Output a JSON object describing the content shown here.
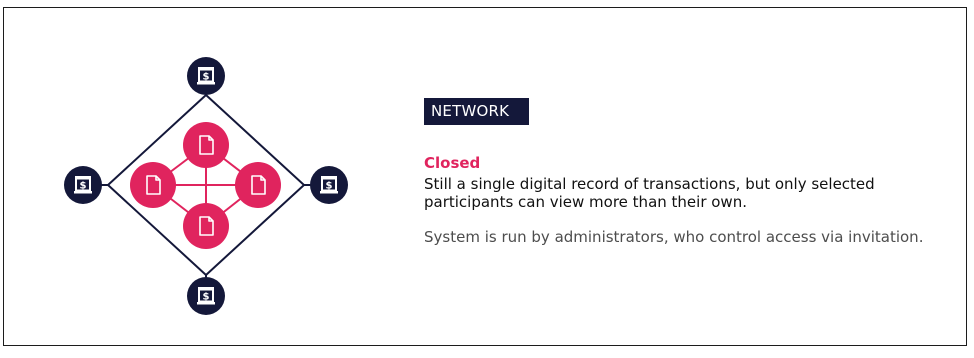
{
  "network": {
    "tag_label": "NETWORK",
    "heading": "Closed",
    "description": "Still a single digital record of transactions, but only selected participants can view more than their own.",
    "note": "System is run by administrators, who control access via invitation."
  },
  "colors": {
    "navy": "#14183a",
    "crimson": "#e0245e",
    "accent_text": "#e0245e"
  },
  "icons": {
    "bank": "bank-icon",
    "document": "document-icon"
  }
}
